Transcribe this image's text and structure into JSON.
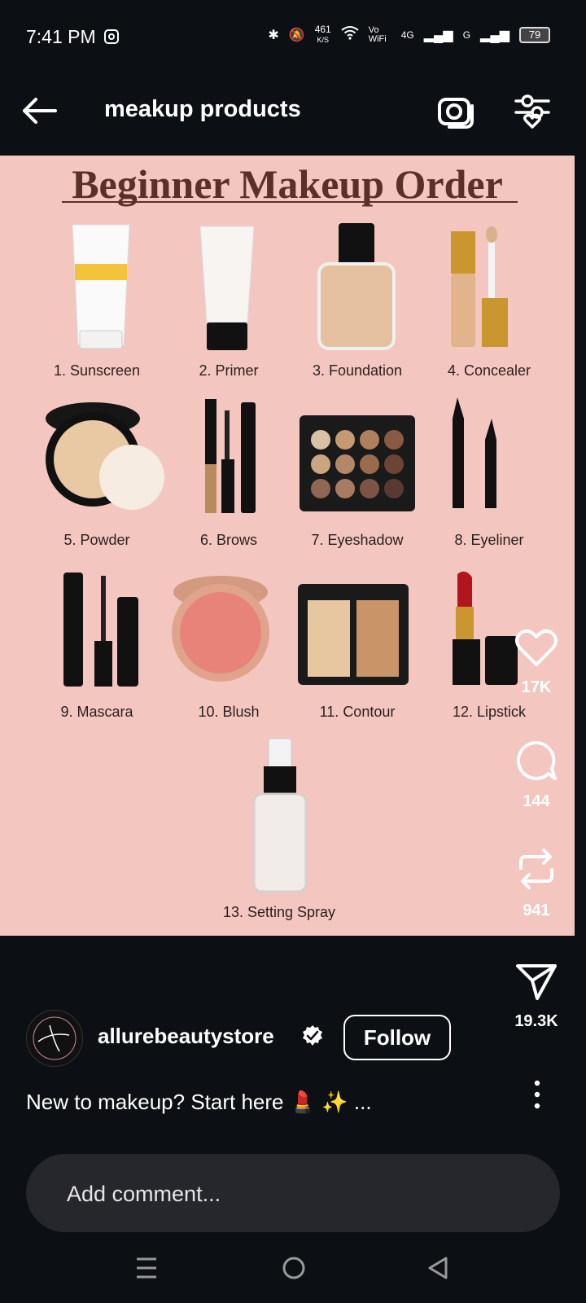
{
  "status_bar": {
    "time": "7:41 PM",
    "speed_value": "461",
    "speed_unit": "K/S",
    "network_1": "Vo WiFi",
    "network_2": "4G",
    "network_3": "G",
    "battery": "79"
  },
  "header": {
    "title": "meakup products"
  },
  "post": {
    "title": "Beginner Makeup Order",
    "items": [
      "1. Sunscreen",
      "2. Primer",
      "3. Foundation",
      "4. Concealer",
      "5. Powder",
      "6. Brows",
      "7. Eyeshadow",
      "8. Eyeliner",
      "9. Mascara",
      "10. Blush",
      "11. Contour",
      "12. Lipstick",
      "13. Setting Spray"
    ]
  },
  "actions": {
    "likes": "17K",
    "comments": "144",
    "reposts": "941",
    "shares": "19.3K"
  },
  "author": {
    "username": "allurebeautystore",
    "follow_label": "Follow",
    "caption": "New to makeup? Start here 💄 ✨ ..."
  },
  "comment_box": {
    "placeholder": "Add comment..."
  },
  "icons": [
    "back-arrow-icon",
    "camera-icon",
    "filter-icon",
    "heart-icon",
    "comment-icon",
    "repost-icon",
    "send-icon",
    "verified-icon",
    "more-icon",
    "menu-icon",
    "home-icon",
    "back-nav-icon"
  ]
}
